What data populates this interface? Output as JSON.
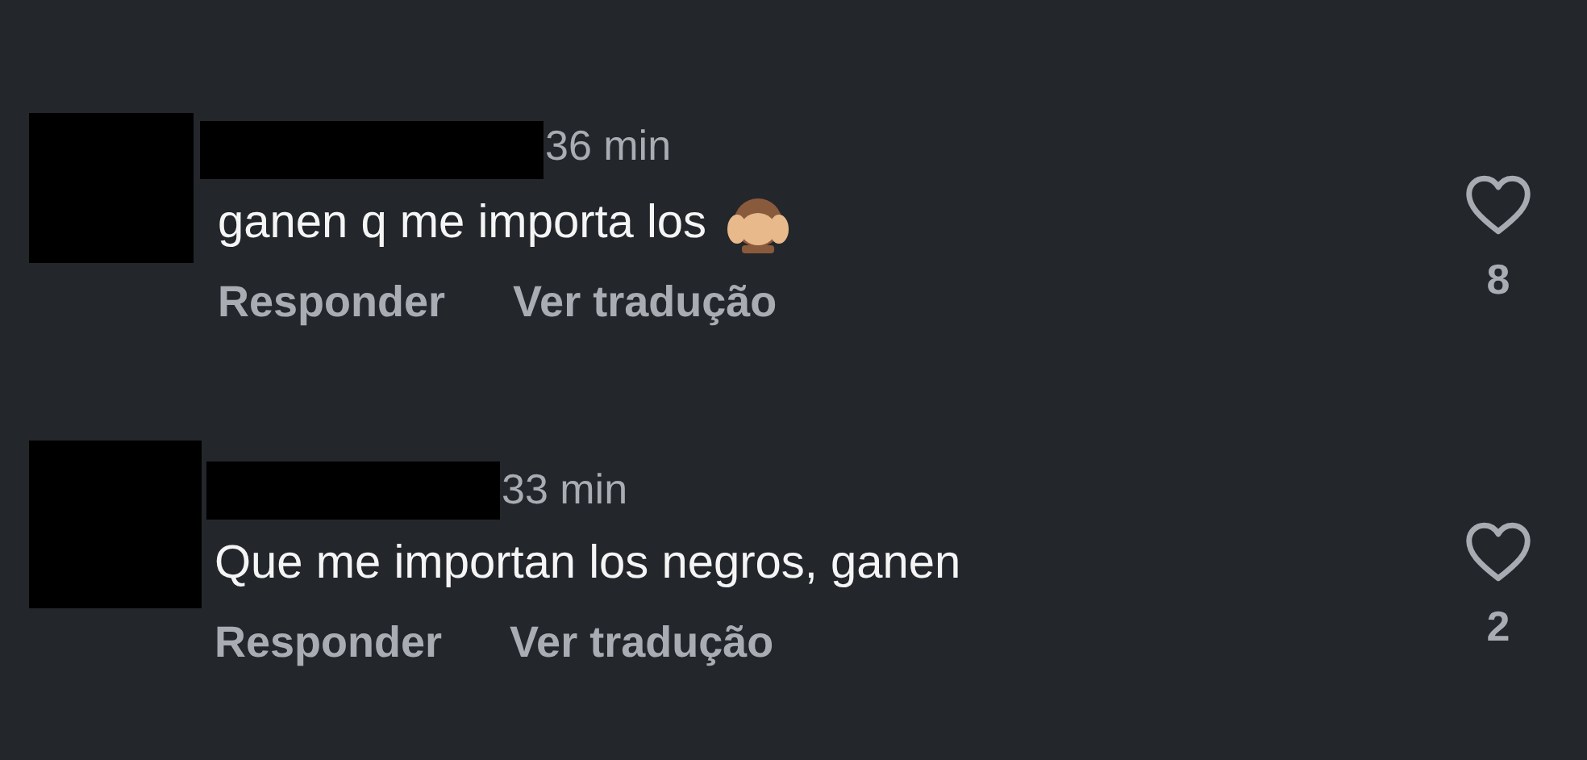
{
  "comments": [
    {
      "time": "36 min",
      "text": "ganen q me importa los",
      "emoji": true,
      "actions": [
        "Responder",
        "Ver tradução"
      ],
      "likes": "8",
      "liked": false
    },
    {
      "time": "33 min",
      "text": "Que me importan los negros, ganen",
      "emoji": false,
      "actions": [
        "Responder",
        "Ver tradução"
      ],
      "likes": "2",
      "liked": false
    }
  ]
}
